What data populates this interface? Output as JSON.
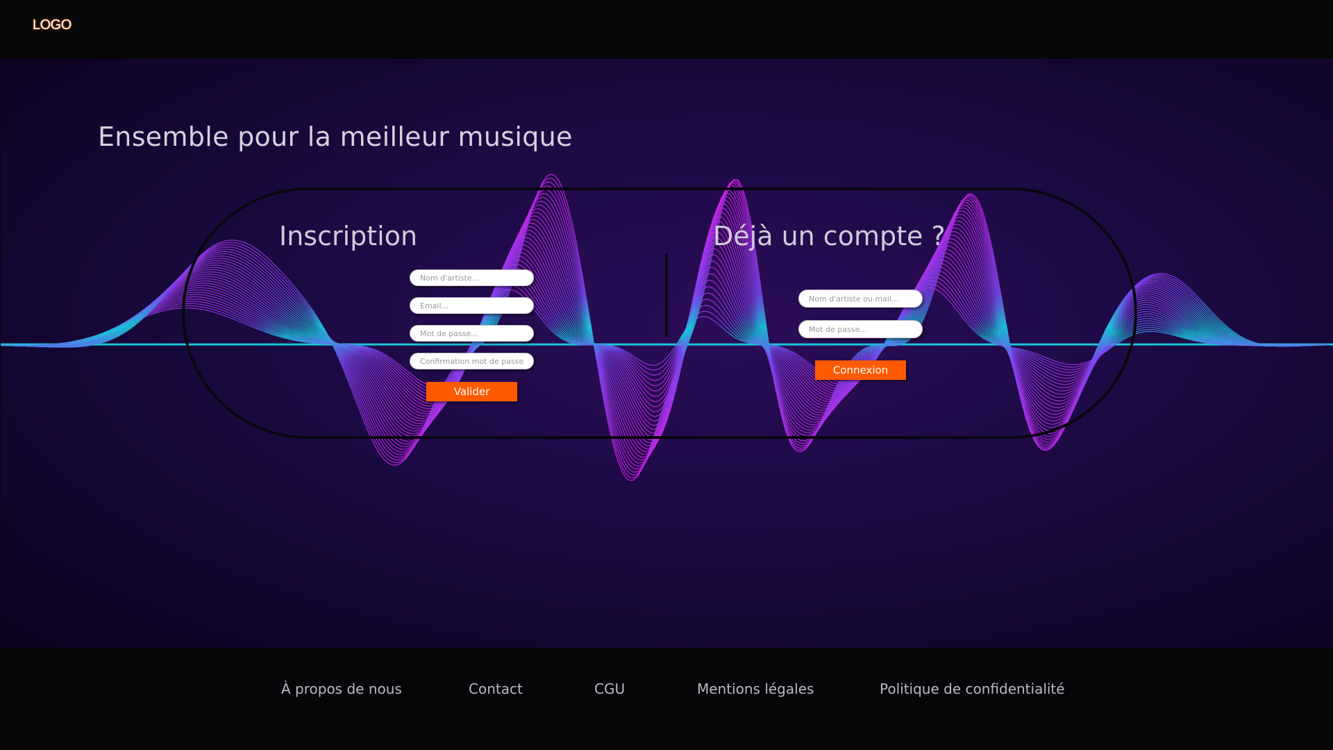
{
  "header": {
    "logo_text": "LOGO"
  },
  "hero": {
    "headline": "Ensemble pour la meilleur musique",
    "background_wave_colors": [
      "#00c8e0",
      "#c81ee0",
      "#8a3cf0"
    ]
  },
  "register": {
    "title": "Inscription",
    "fields": [
      {
        "placeholder": "Nom d'artiste...",
        "value": ""
      },
      {
        "placeholder": "Email...",
        "value": ""
      },
      {
        "placeholder": "Mot de passe...",
        "value": ""
      },
      {
        "placeholder": "Confirmation mot de passe...",
        "value": ""
      }
    ],
    "submit_label": "Valider"
  },
  "login": {
    "title": "Déjà un compte ?",
    "fields": [
      {
        "placeholder": "Nom d'artiste ou mail...",
        "value": ""
      },
      {
        "placeholder": "Mot de passe...",
        "value": ""
      }
    ],
    "submit_label": "Connexion"
  },
  "footer": {
    "links": [
      {
        "label": "À propos de nous"
      },
      {
        "label": "Contact"
      },
      {
        "label": "CGU"
      },
      {
        "label": "Mentions légales"
      },
      {
        "label": "Politique de confidentialité"
      }
    ]
  },
  "colors": {
    "accent": "#ff5a00",
    "header_bg": "#060608",
    "hero_bg": "#1d0a45"
  }
}
